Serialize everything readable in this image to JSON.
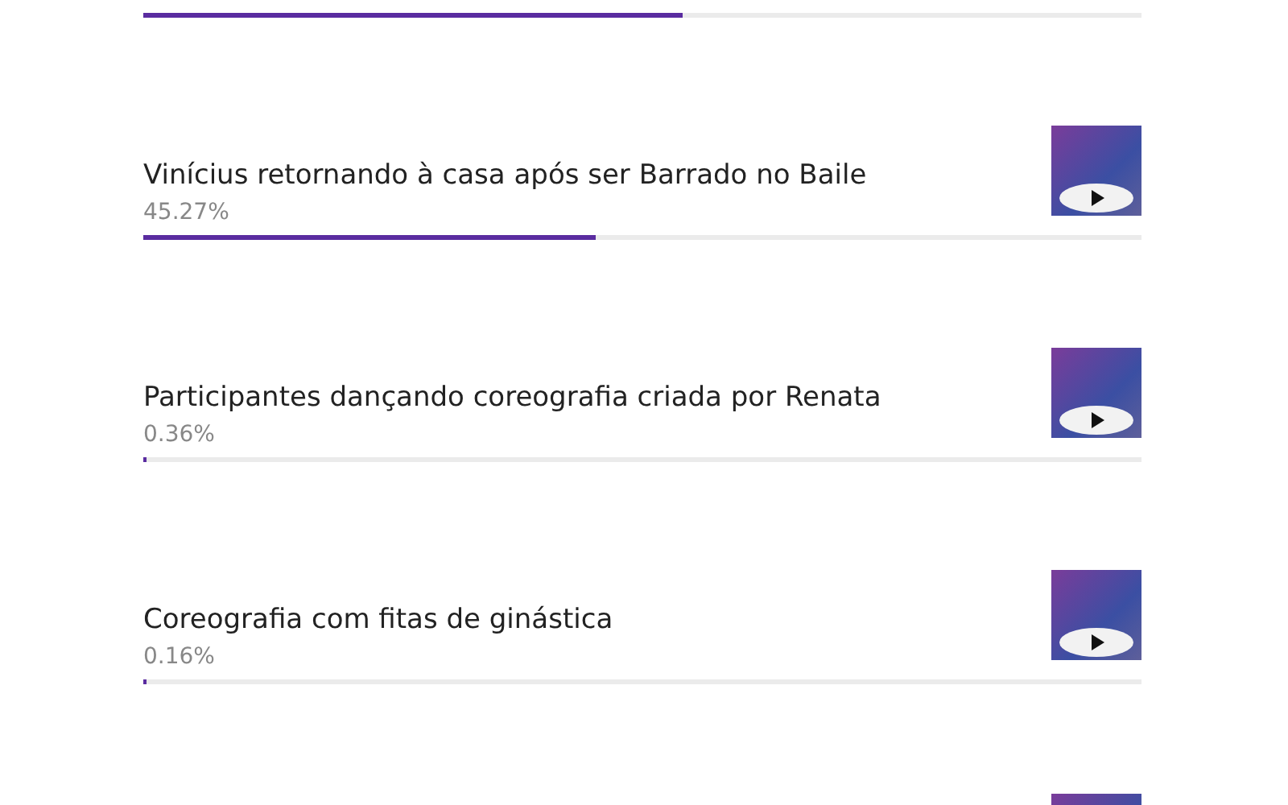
{
  "top_bar": {
    "level": 0.54
  },
  "items": [
    {
      "title": "Vinícius retornando à casa após ser Barrado no Baile",
      "percent": "45.27%",
      "level": 0.4527
    },
    {
      "title": "Participantes dançando coreografia criada por Renata",
      "percent": "0.36%",
      "level": 0.0036
    },
    {
      "title": "Coreografia com fitas de ginástica",
      "percent": "0.16%",
      "level": 0.0016
    }
  ]
}
